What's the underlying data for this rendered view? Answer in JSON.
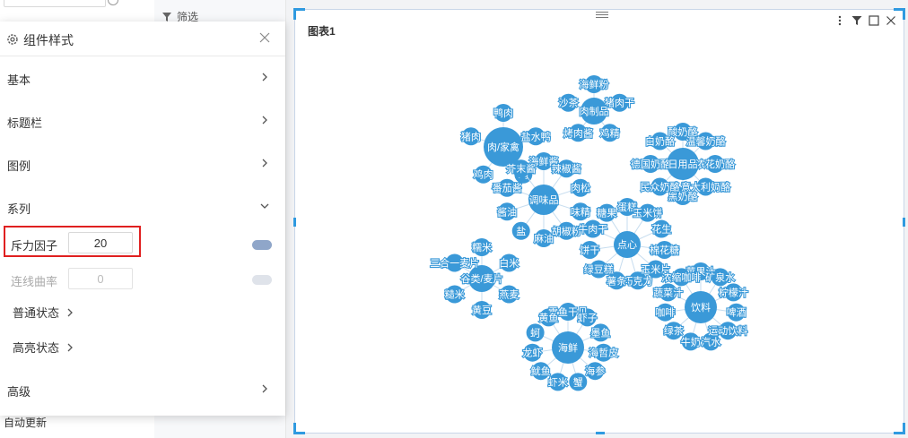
{
  "left_column": {
    "auto_update": "自动更新"
  },
  "filter": {
    "label": "筛选"
  },
  "chart": {
    "title": "图表1",
    "tools": {
      "more": "more-icon",
      "filter": "filter-icon",
      "maximize": "maximize-icon",
      "close": "close-icon"
    }
  },
  "style_panel": {
    "title": "组件样式",
    "sections": {
      "basic": "基本",
      "title_bar": "标题栏",
      "legend": "图例",
      "series": "系列",
      "advanced": "高级"
    },
    "repulsion": {
      "label": "斥力因子",
      "value": "20"
    },
    "curveness": {
      "label": "连线曲率",
      "value": "0"
    },
    "normal_state": "普通状态",
    "highlight_state": "高亮状态"
  },
  "colors": {
    "node": "#3a99d8",
    "accent": "#2f9ae0",
    "highlight_border": "#e02020"
  },
  "chart_data": {
    "type": "graph",
    "groups": [
      {
        "center": "肉/家禽",
        "children": [
          "鸭肉",
          "盐水鸭",
          "鸡",
          "鸡肉",
          "猪肉"
        ]
      },
      {
        "center": "调味品",
        "children": [
          "海鲜酱",
          "辣椒酱",
          "肉松",
          "味精",
          "胡椒粉",
          "麻油",
          "盐",
          "酱油",
          "番茄酱",
          "芥末酱"
        ]
      },
      {
        "center": "肉制品",
        "children": [
          "海鲜粉",
          "猪肉干",
          "鸡精",
          "烤肉酱",
          "沙茶"
        ]
      },
      {
        "center": "日用品",
        "children": [
          "酸奶酪",
          "温馨奶酪",
          "浓花奶酪",
          "意大利奶酪",
          "黑奶酪",
          "民众奶酪",
          "德国奶酪",
          "白奶酪"
        ]
      },
      {
        "center": "点心",
        "children": [
          "蛋糕",
          "玉米饼",
          "花生",
          "棉花糖",
          "玉米片",
          "巧克力",
          "薯条",
          "绿豆糕",
          "饼干",
          "牛肉干",
          "糖果"
        ]
      },
      {
        "center": "谷类/麦片",
        "children": [
          "糯米",
          "白米",
          "燕麦",
          "黄豆",
          "糙米",
          "三合一麦片"
        ]
      },
      {
        "center": "饮料",
        "children": [
          "苹果汁",
          "矿泉水",
          "柠檬汁",
          "啤酒",
          "运动饮料",
          "汽水",
          "牛奶",
          "绿茶",
          "咖啡",
          "蔬菜汁",
          "浓缩咖啡"
        ]
      },
      {
        "center": "海鲜",
        "children": [
          "雪鱼干贝",
          "虾子",
          "墨鱼",
          "海哲皮",
          "海参",
          "蟹",
          "虾米",
          "鱿鱼",
          "龙虾",
          "蚵",
          "黄鱼"
        ]
      }
    ]
  }
}
